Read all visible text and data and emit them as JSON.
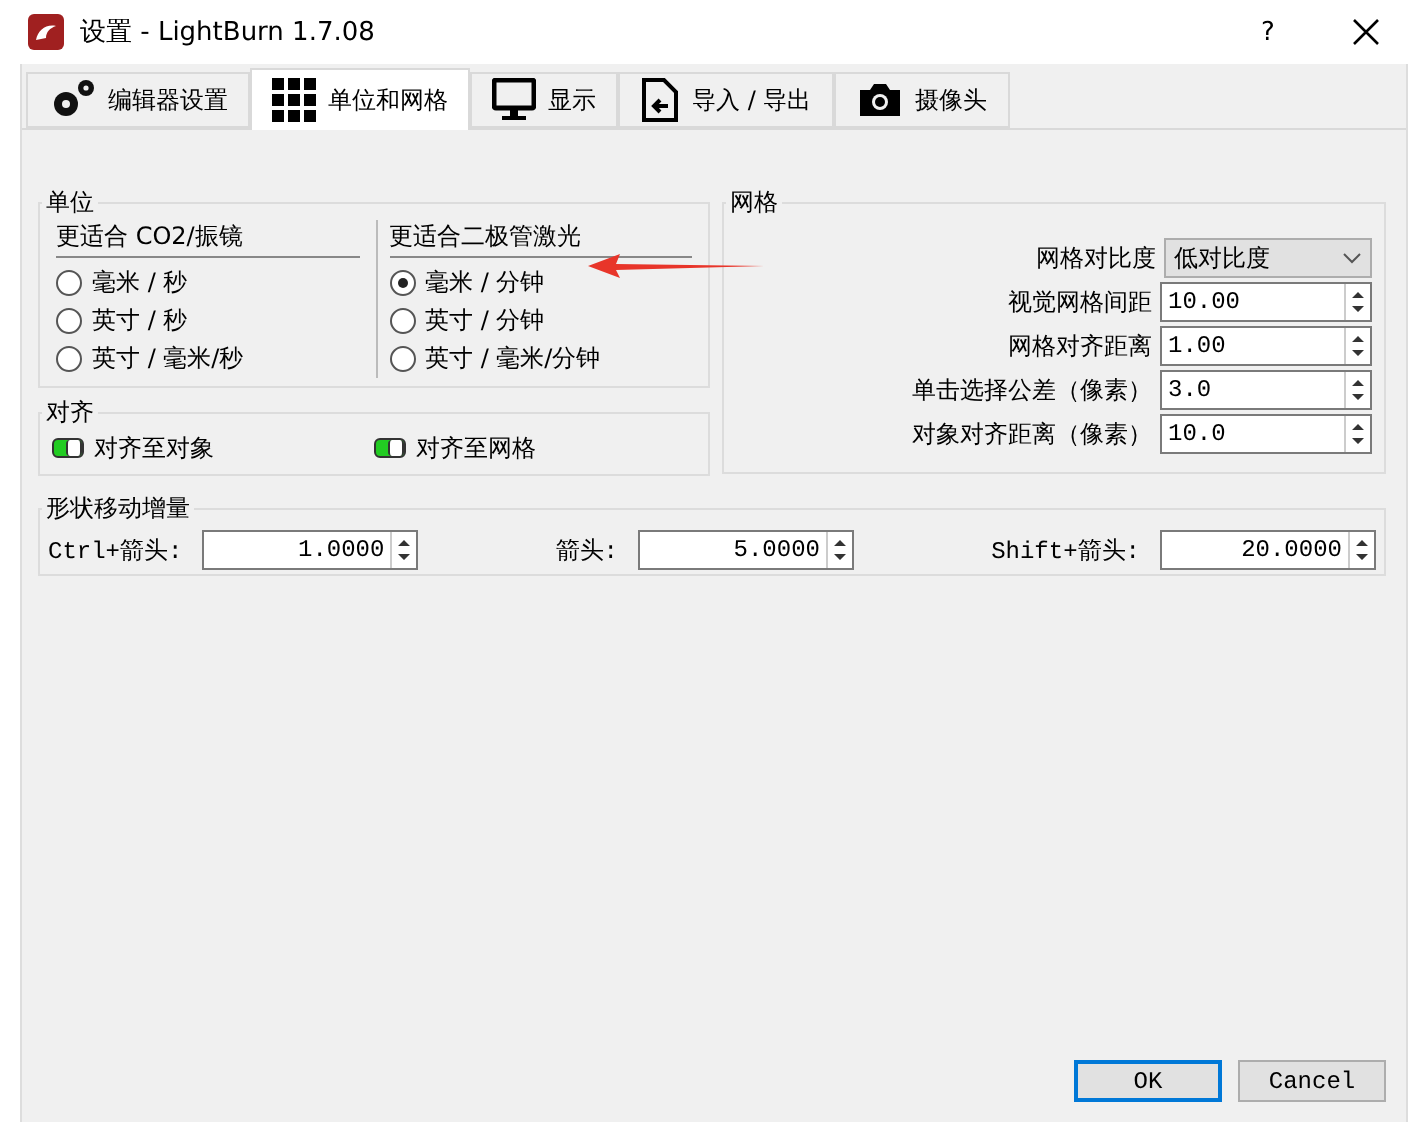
{
  "window": {
    "title": "设置 - LightBurn 1.7.08",
    "help": "?"
  },
  "tabs": [
    {
      "label": "编辑器设置",
      "kind": "gears",
      "selected": false
    },
    {
      "label": "单位和网格",
      "kind": "grid",
      "selected": true
    },
    {
      "label": "显示",
      "kind": "monitor",
      "selected": false
    },
    {
      "label": "导入 / 导出",
      "kind": "import",
      "selected": false
    },
    {
      "label": "摄像头",
      "kind": "camera",
      "selected": false
    }
  ],
  "units": {
    "title": "单位",
    "columns": [
      {
        "title": "更适合 CO2/振镜",
        "options": [
          {
            "label": "毫米 / 秒",
            "selected": false
          },
          {
            "label": "英寸 / 秒",
            "selected": false
          },
          {
            "label": "英寸 / 毫米/秒",
            "selected": false
          }
        ]
      },
      {
        "title": "更适合二极管激光",
        "options": [
          {
            "label": "毫米 / 分钟",
            "selected": true
          },
          {
            "label": "英寸 / 分钟",
            "selected": false
          },
          {
            "label": "英寸 / 毫米/分钟",
            "selected": false
          }
        ]
      }
    ]
  },
  "snap": {
    "title": "对齐",
    "toggles": [
      {
        "label": "对齐至对象",
        "on": true
      },
      {
        "label": "对齐至网格",
        "on": true
      }
    ]
  },
  "grid": {
    "title": "网格",
    "rows": [
      {
        "label": "网格对比度",
        "kind": "select",
        "value": "低对比度"
      },
      {
        "label": "视觉网格间距",
        "kind": "spin",
        "value": "10.00"
      },
      {
        "label": "网格对齐距离",
        "kind": "spin",
        "value": "1.00"
      },
      {
        "label": "单击选择公差（像素）",
        "kind": "spin",
        "value": "3.0"
      },
      {
        "label": "对象对齐距离（像素）",
        "kind": "spin",
        "value": "10.0"
      }
    ]
  },
  "increments": {
    "title": "形状移动增量",
    "items": [
      {
        "label": "Ctrl+箭头:",
        "value": "1.0000"
      },
      {
        "label": "箭头:",
        "value": "5.0000"
      },
      {
        "label": "Shift+箭头:",
        "value": "20.0000"
      }
    ]
  },
  "buttons": [
    {
      "label": "OK",
      "default": true
    },
    {
      "label": "Cancel",
      "default": false
    }
  ]
}
